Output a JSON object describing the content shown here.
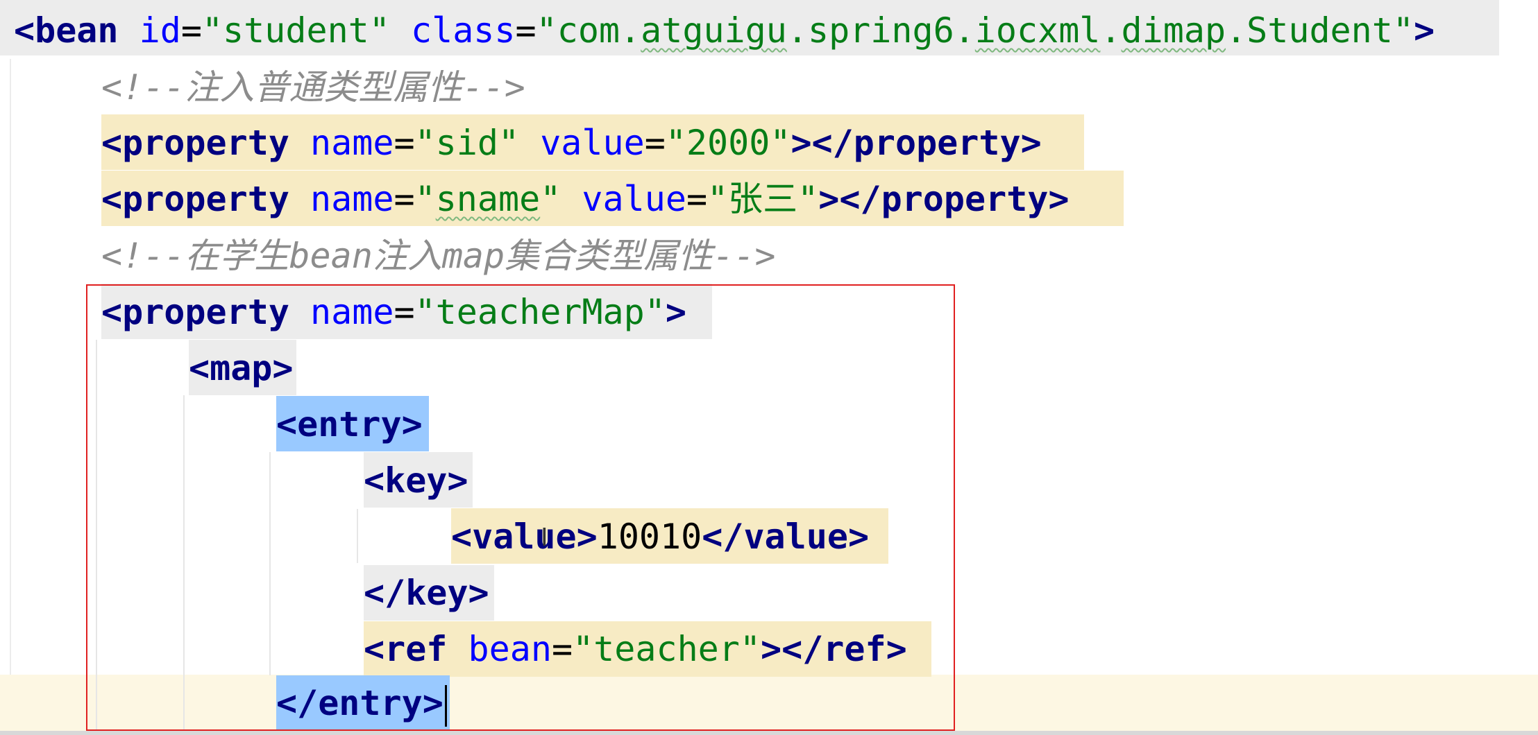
{
  "lines": [
    {
      "tag_open": "<bean",
      "attr1": "id",
      "eq1": "=",
      "val1": "\"student\"",
      "attr2": "class",
      "eq2": "=",
      "val2_a": "\"com.",
      "val2_b": "atguigu",
      "val2_c": ".spring6.",
      "val2_d": "iocxml",
      "val2_e": ".",
      "val2_f": "dimap",
      "val2_g": ".Student\"",
      "tag_close": ">"
    },
    {
      "comment": "<!--注入普通类型属性-->"
    },
    {
      "tag_open": "<property",
      "attr1": "name",
      "eq1": "=",
      "val1": "\"sid\"",
      "attr2": "value",
      "eq2": "=",
      "val2": "\"2000\"",
      "tag_close": "></property>"
    },
    {
      "tag_open": "<property",
      "attr1": "name",
      "eq1": "=",
      "val1_a": "\"",
      "val1_b": "sname",
      "val1_c": "\"",
      "attr2": "value",
      "eq2": "=",
      "val2": "\"张三\"",
      "tag_close": "></property>"
    },
    {
      "comment": "<!--在学生bean注入map集合类型属性-->"
    },
    {
      "tag_open": "<property",
      "attr1": "name",
      "eq1": "=",
      "val1": "\"teacherMap\"",
      "tag_close": ">"
    },
    {
      "tag": "<map>"
    },
    {
      "tag": "<entry>"
    },
    {
      "tag": "<key>"
    },
    {
      "tag_open": "<value>",
      "text": "10010",
      "tag_close": "</value>"
    },
    {
      "tag": "</key>"
    },
    {
      "tag_open": "<ref",
      "attr1": "bean",
      "eq1": "=",
      "val1": "\"teacher\"",
      "tag_close": "></ref>"
    },
    {
      "tag": "</entry>"
    }
  ],
  "colors": {
    "tag": "#000080",
    "attribute": "#0000ff",
    "string": "#067d17",
    "comment": "#8c8c8c",
    "highlight_yellow": "#f7ebc4",
    "highlight_blue": "#99c9ff",
    "highlight_gray": "#ececec",
    "selection_box": "#e02020"
  },
  "icons": {
    "text_cursor": "I"
  }
}
